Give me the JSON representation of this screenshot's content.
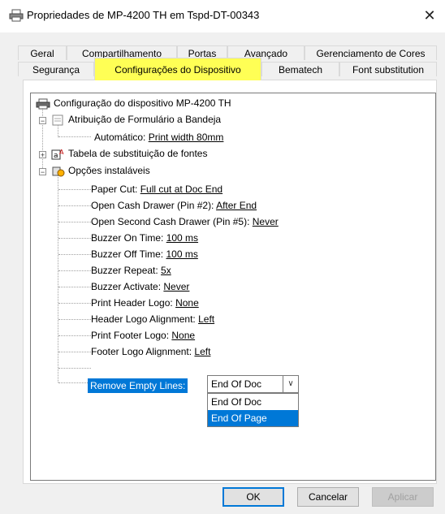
{
  "window": {
    "title": "Propriedades de MP-4200 TH em Tspd-DT-00343",
    "close_label": "✕"
  },
  "tabs_row1": [
    {
      "label": "Geral"
    },
    {
      "label": "Compartilhamento"
    },
    {
      "label": "Portas"
    },
    {
      "label": "Avançado"
    },
    {
      "label": "Gerenciamento de Cores"
    }
  ],
  "tabs_row2": [
    {
      "label": "Segurança"
    },
    {
      "label": "Configurações do Dispositivo"
    },
    {
      "label": "Bematech"
    },
    {
      "label": "Font substitution"
    }
  ],
  "tree": {
    "root": "Configuração do dispositivo MP-4200 TH",
    "form_to_tray": "Atribuição de Formulário a Bandeja",
    "auto": {
      "name": "Automático: ",
      "value": "Print width 80mm"
    },
    "font_table": "Tabela de substituição de fontes",
    "installable": "Opções instaláveis",
    "options": [
      {
        "name": "Paper Cut: ",
        "value": "Full cut at Doc End"
      },
      {
        "name": "Open Cash Drawer (Pin #2): ",
        "value": "After End"
      },
      {
        "name": "Open Second Cash Drawer (Pin #5): ",
        "value": "Never"
      },
      {
        "name": "Buzzer On Time: ",
        "value": "100 ms"
      },
      {
        "name": "Buzzer Off Time: ",
        "value": "100 ms"
      },
      {
        "name": "Buzzer Repeat: ",
        "value": "5x"
      },
      {
        "name": "Buzzer Activate: ",
        "value": "Never"
      },
      {
        "name": "Print Header Logo: ",
        "value": "None"
      },
      {
        "name": "Header Logo Alignment: ",
        "value": "Left"
      },
      {
        "name": "Print Footer Logo: ",
        "value": "None"
      },
      {
        "name": "Footer Logo Alignment: ",
        "value": "Left"
      }
    ],
    "selected": {
      "name": "Remove Empty Lines:",
      "combo_value": "End Of Doc",
      "options": [
        "End Of Doc",
        "End Of Page"
      ]
    }
  },
  "buttons": {
    "ok": "OK",
    "cancel": "Cancelar",
    "apply": "Aplicar"
  },
  "colors": {
    "highlight": "#0078d7",
    "active_tab": "#ffff55"
  }
}
